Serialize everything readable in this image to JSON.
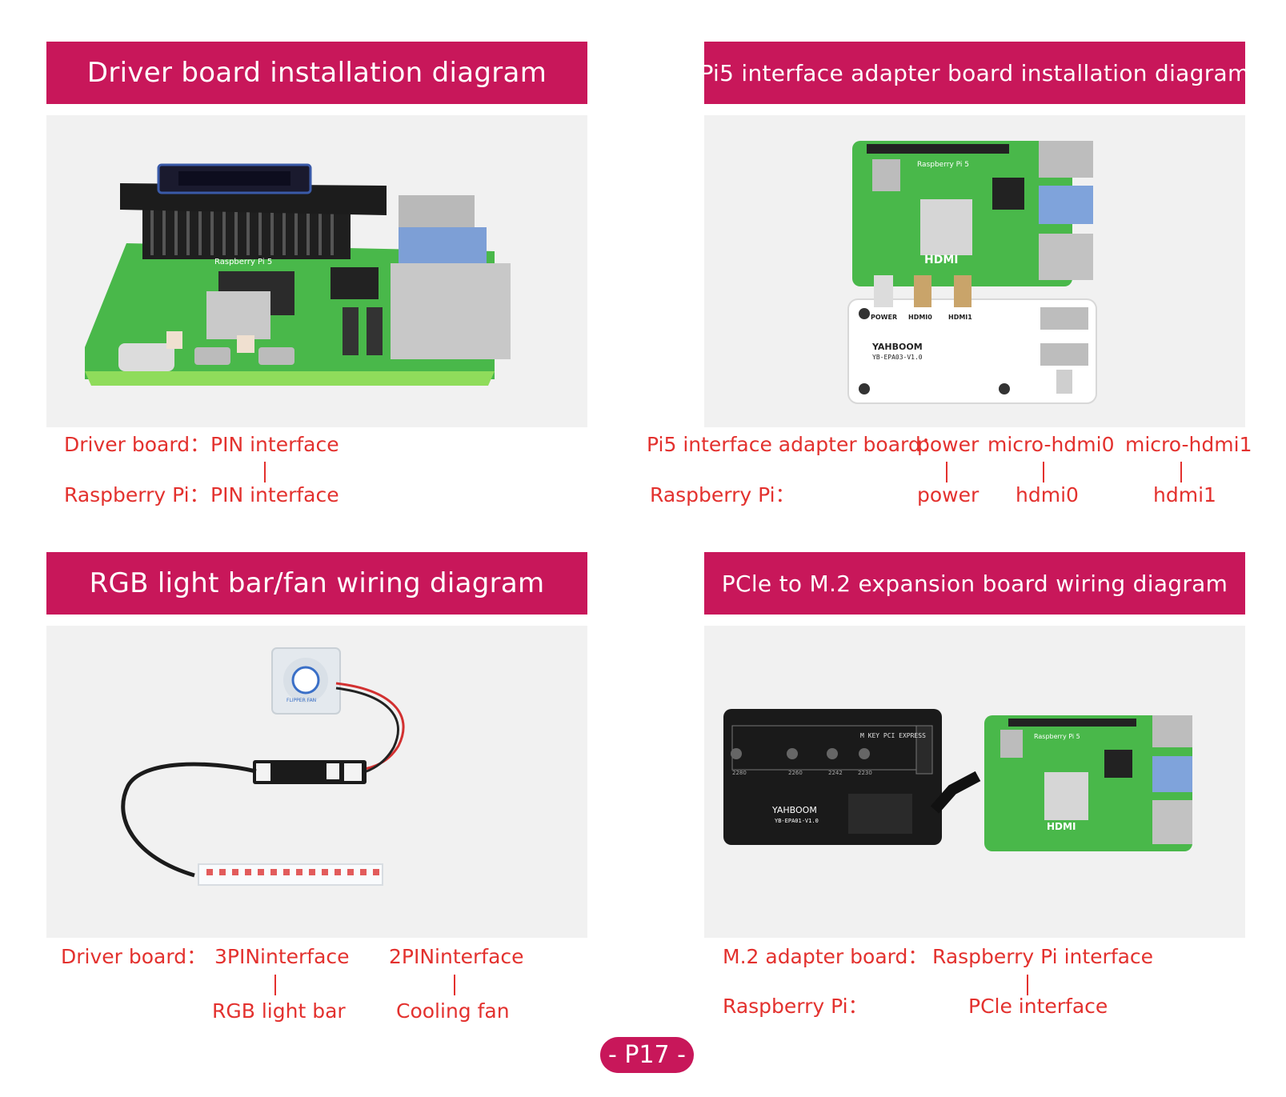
{
  "panels": {
    "driver": {
      "title": "Driver board installation diagram",
      "labels": {
        "row1_left": "Driver board：",
        "row1_a": "PIN interface",
        "row2_left": "Raspberry Pi：",
        "row2_a": "PIN interface"
      },
      "photo": {
        "oled_text": "",
        "board_text": "Raspberry Pi 5"
      }
    },
    "pi5_adapter": {
      "title": "Pi5 interface adapter board installation diagram",
      "labels": {
        "row1_left": "Pi5 interface adapter board：",
        "row1_a": "power",
        "row1_b": "micro-hdmi0",
        "row1_c": "micro-hdmi1",
        "row2_left": "Raspberry Pi：",
        "row2_a": "power",
        "row2_b": "hdmi0",
        "row2_c": "hdmi1"
      },
      "photo": {
        "board_text": "Raspberry Pi 5",
        "hdmi_text": "HDMI",
        "brand_text": "YAHBOOM",
        "model_text": "YB-EPA03-V1.0",
        "port_power": "POWER",
        "port_hdmi0": "HDMI0",
        "port_hdmi1": "HDMI1",
        "side_hdmi": "HDMI",
        "side_power": "POWER"
      }
    },
    "rgb_fan": {
      "title": "RGB light bar/fan wiring diagram",
      "labels": {
        "row1_left": "Driver board：",
        "row1_a": "3PINinterface",
        "row1_b": "2PINinterface",
        "row2_a": "RGB light bar",
        "row2_b": "Cooling fan"
      },
      "photo": {
        "fan_text": "FLIPPER FAN"
      }
    },
    "pcie_m2": {
      "title": "PCle to M.2 expansion board wiring diagram",
      "labels": {
        "row1_left": "M.2 adapter board：",
        "row1_a": "Raspberry Pi interface",
        "row2_left": "Raspberry Pi：",
        "row2_a": "PCle interface"
      },
      "photo": {
        "mkey_text": "M KEY PCI EXPRESS",
        "sizes": [
          "2280",
          "2260",
          "2242",
          "2230"
        ],
        "brand_text": "YAHBOOM",
        "model_text": "YB-EPA01-V1.0",
        "board_text": "Raspberry Pi 5",
        "hdmi_text": "HDMI"
      }
    }
  },
  "page_number": "- P17 -",
  "colors": {
    "banner": "#c8175a",
    "label_text": "#e3312e",
    "pcb_green": "#49b84a",
    "photo_bg": "#f1f1f1"
  }
}
